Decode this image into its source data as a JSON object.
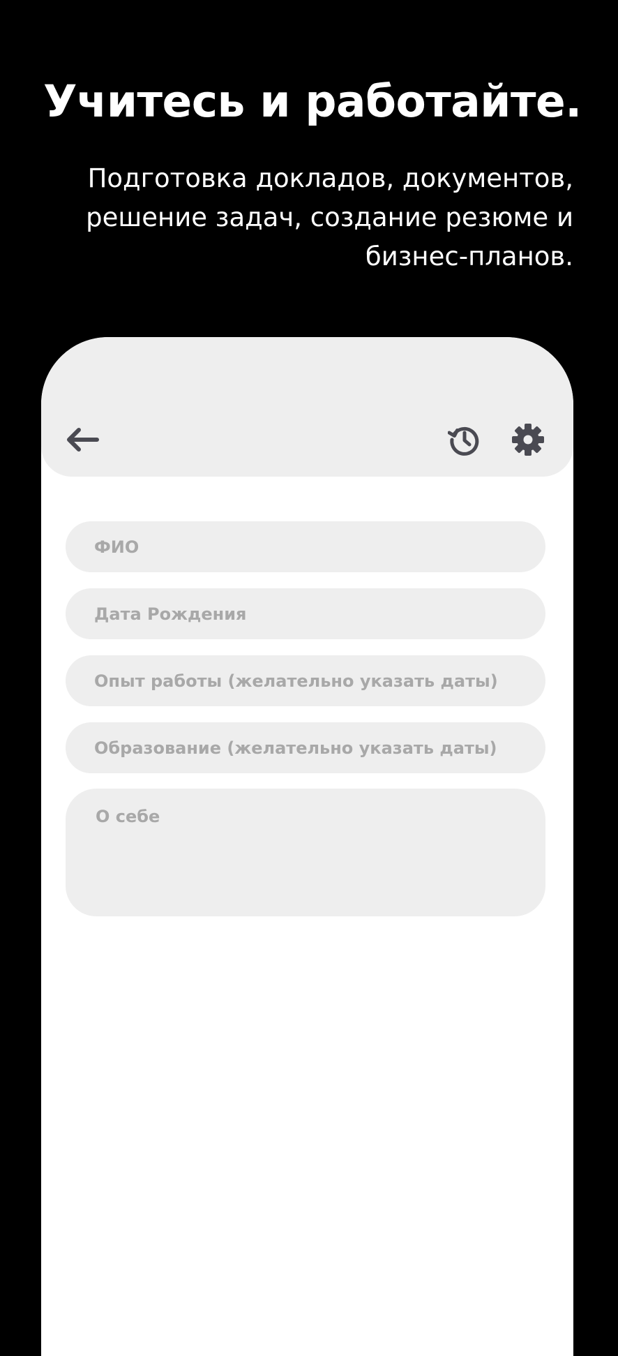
{
  "promo": {
    "headline": "Учитесь и работайте.",
    "subtitle": "Подготовка докладов, документов, решение задач, создание резюме и бизнес-планов."
  },
  "app_bar": {
    "back_icon": "arrow-left-icon",
    "history_icon": "history-icon",
    "settings_icon": "gear-icon"
  },
  "form": {
    "fields": [
      {
        "placeholder": "ФИО"
      },
      {
        "placeholder": "Дата Рождения"
      },
      {
        "placeholder": "Опыт работы (желательно указать даты)"
      },
      {
        "placeholder": "Образование (желательно указать даты)"
      },
      {
        "placeholder": "О себе"
      }
    ]
  },
  "colors": {
    "background": "#000000",
    "surface": "#ffffff",
    "field_background": "#eeeeee",
    "placeholder_text": "#a8a8a8",
    "icon": "#4a4a52"
  }
}
